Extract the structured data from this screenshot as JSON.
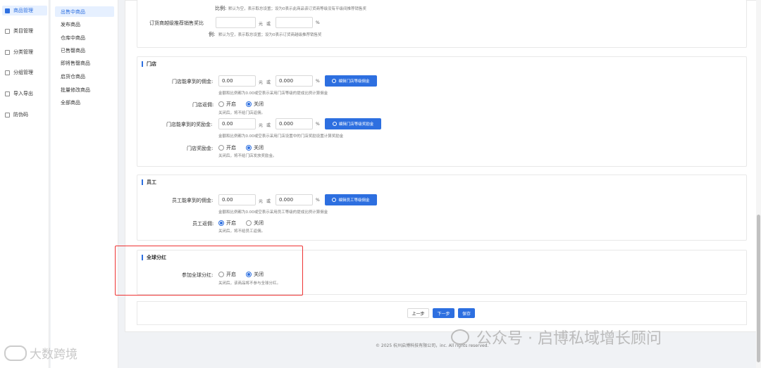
{
  "nav_primary": [
    {
      "label": "商品管理",
      "icon": "box-icon",
      "active": true
    },
    {
      "label": "类目管理",
      "icon": "category-icon"
    },
    {
      "label": "分类管理",
      "icon": "classify-icon"
    },
    {
      "label": "分组管理",
      "icon": "group-icon"
    },
    {
      "label": "导入导出",
      "icon": "import-export-icon"
    },
    {
      "label": "防伪码",
      "icon": "shield-icon"
    }
  ],
  "nav_secondary": [
    {
      "label": "出售中商品",
      "active": true
    },
    {
      "label": "发布商品"
    },
    {
      "label": "仓库中商品"
    },
    {
      "label": "已售罄商品"
    },
    {
      "label": "即将售罄商品"
    },
    {
      "label": "启货仓商品"
    },
    {
      "label": "批量修改商品"
    },
    {
      "label": "全部商品"
    }
  ],
  "top_section": {
    "ratio_label": "比例:",
    "ratio_hint": "默认为空，表示取总设置；设为0表示此商品该订货商等级没有平级间推荐销售奖",
    "cross_label": "订货商越级推荐销售奖比",
    "cross_label2": "例:",
    "unit_yuan": "元",
    "unit_or": "或",
    "unit_percent": "%",
    "cross_hint": "默认为空，表示取总设置；设为0表示订货商越级推荐销售奖"
  },
  "store_section": {
    "title": "门店",
    "commission_label": "门店能拿到的佣金:",
    "commission_amount": "0.00",
    "commission_ratio": "0.000",
    "unit_yuan": "元",
    "unit_or": "或",
    "unit_percent": "%",
    "commission_btn": "编辑门店等级佣金",
    "commission_hint": "金额和比例都为0.00或空表示采用门店等级的提成比例计算佣金",
    "rebate_label": "门店返佣:",
    "rebate_on": "开启",
    "rebate_off": "关闭",
    "rebate_hint": "关闭后，将不给门店返佣。",
    "bonus_label": "门店能拿到的奖励金:",
    "bonus_amount": "0.00",
    "bonus_ratio": "0.000",
    "bonus_btn": "编辑门店等级奖励金",
    "bonus_hint": "金额和比例都为0.00或空表示采用门店设置中的门店奖励设置计算奖励金",
    "bonus_switch_label": "门店奖励金:",
    "bonus_switch_hint": "关闭后，将不给门店发放奖励金。"
  },
  "staff_section": {
    "title": "员工",
    "commission_label": "员工能拿到的佣金:",
    "commission_amount": "0.00",
    "commission_ratio": "0.000",
    "unit_yuan": "元",
    "unit_or": "或",
    "unit_percent": "%",
    "commission_btn": "编辑员工等级佣金",
    "commission_hint": "金额和比例都为0.00或空表示采用员工等级的提成比例计算佣金",
    "rebate_label": "员工返佣:",
    "rebate_on": "开启",
    "rebate_off": "关闭",
    "rebate_hint": "关闭后，将不给员工返佣。"
  },
  "global_section": {
    "title": "全球分红",
    "join_label": "参加全球分红:",
    "on": "开启",
    "off": "关闭",
    "hint": "关闭后，该商品将不参与全球分红。"
  },
  "footer": {
    "prev": "上一步",
    "next": "下一步",
    "save": "保存",
    "copyright": "© 2025 杭州启博科技有限公司，inc. All rights reserved."
  },
  "watermarks": {
    "wechat": "公众号 · 启博私域增长顾问",
    "brand": "大数跨境"
  },
  "colors": {
    "accent": "#2d6fe0",
    "highlight_frame": "#ee3333"
  }
}
